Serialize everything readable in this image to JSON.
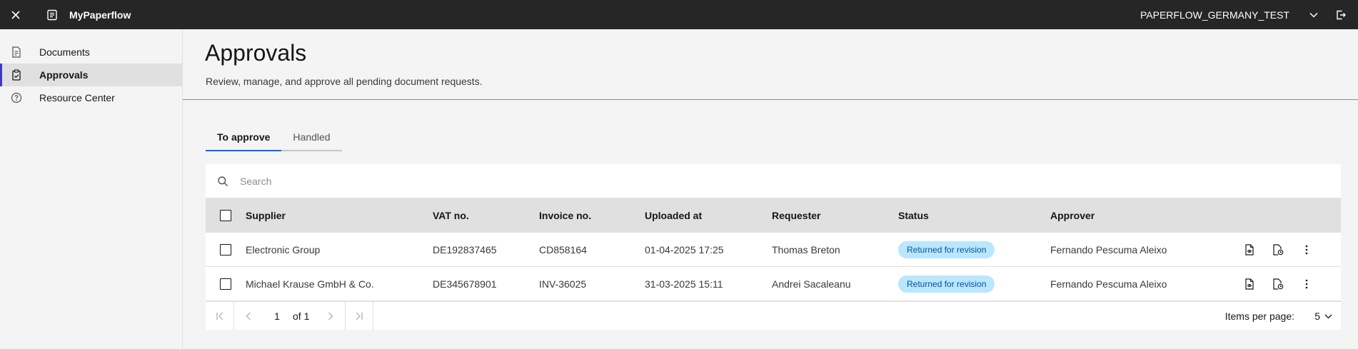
{
  "header": {
    "app_name": "MyPaperflow",
    "org_name": "PAPERFLOW_GERMANY_TEST"
  },
  "sidebar": {
    "items": [
      {
        "label": "Documents",
        "icon": "document-icon"
      },
      {
        "label": "Approvals",
        "icon": "clipboard-check-icon",
        "active": true
      },
      {
        "label": "Resource Center",
        "icon": "help-circle-icon"
      }
    ]
  },
  "page": {
    "title": "Approvals",
    "subtitle": "Review, manage, and approve all pending document requests."
  },
  "tabs": [
    {
      "label": "To approve",
      "active": true
    },
    {
      "label": "Handled",
      "active": false
    }
  ],
  "search": {
    "placeholder": "Search"
  },
  "table": {
    "columns": [
      "Supplier",
      "VAT no.",
      "Invoice no.",
      "Uploaded at",
      "Requester",
      "Status",
      "Approver"
    ],
    "rows": [
      {
        "supplier": "Electronic Group",
        "vat": "DE192837465",
        "invoice": "CD858164",
        "uploaded": "01-04-2025 17:25",
        "requester": "Thomas Breton",
        "status": "Returned for revision",
        "approver": "Fernando Pescuma Aleixo"
      },
      {
        "supplier": "Michael Krause GmbH & Co.",
        "vat": "DE345678901",
        "invoice": "INV-36025",
        "uploaded": "31-03-2025 15:11",
        "requester": "Andrei Sacaleanu",
        "status": "Returned for revision",
        "approver": "Fernando Pescuma Aleixo"
      }
    ]
  },
  "pagination": {
    "current_page": "1",
    "of_pages": "of 1",
    "items_per_page_label": "Items per page:",
    "items_per_page_value": "5"
  },
  "colors": {
    "topbar": "#262626",
    "accent": "#3d3bc5",
    "tab_active": "#0f62fe",
    "badge_bg": "#bae6ff",
    "badge_text": "#00539a"
  }
}
